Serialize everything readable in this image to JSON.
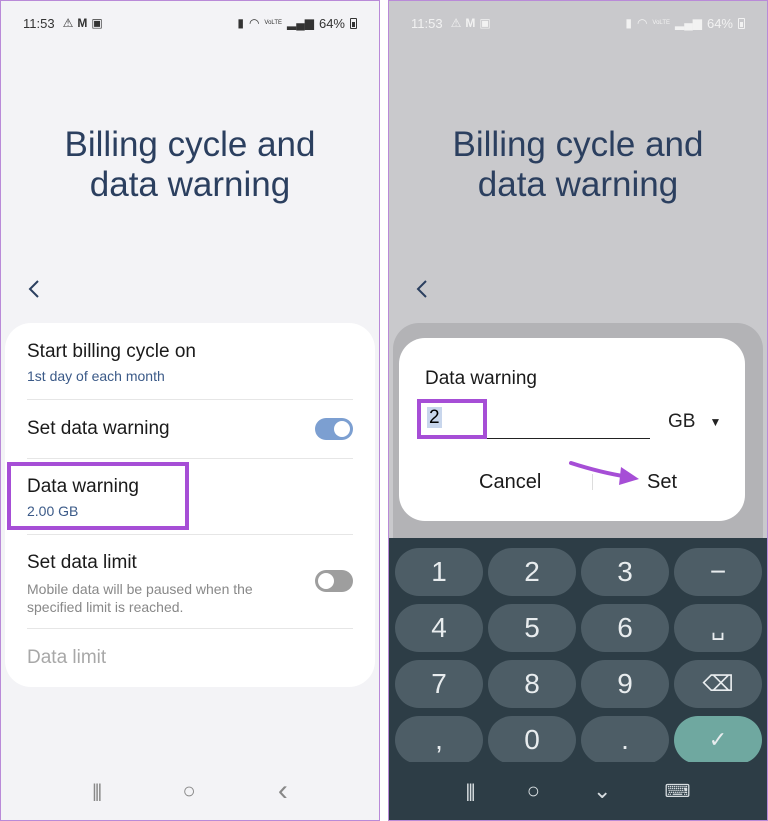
{
  "status": {
    "time": "11:53",
    "battery": "64%",
    "network_label": "VoLTE",
    "icons_left": [
      "warning-icon",
      "gmail-icon",
      "gallery-icon"
    ],
    "icons_right": [
      "sim-icon",
      "wifi-icon",
      "volte-icon",
      "signal-icon",
      "battery-icon"
    ]
  },
  "page_title_line1": "Billing cycle and",
  "page_title_line2": "data warning",
  "settings": {
    "billing_cycle": {
      "title": "Start billing cycle on",
      "value": "1st day of each month"
    },
    "set_data_warning": {
      "title": "Set data warning",
      "toggle": "on"
    },
    "data_warning": {
      "title": "Data warning",
      "value": "2.00 GB"
    },
    "set_data_limit": {
      "title": "Set data limit",
      "description": "Mobile data will be paused when the specified limit is reached.",
      "toggle": "off"
    },
    "data_limit": {
      "title": "Data limit"
    }
  },
  "dialog": {
    "title": "Data warning",
    "input_value": "2",
    "unit": "GB",
    "cancel_label": "Cancel",
    "set_label": "Set"
  },
  "keyboard": {
    "keys": [
      "1",
      "2",
      "3",
      "−",
      "4",
      "5",
      "6",
      "␣",
      "7",
      "8",
      "9",
      "⌫",
      ",",
      "0",
      ".",
      "✓"
    ]
  },
  "nav": {
    "recents": "|||",
    "home": "○",
    "back": "‹",
    "hide_keyboard": "⌄",
    "keyboard_switch": "⌨"
  },
  "colors": {
    "accent_highlight": "#a64ed6",
    "title_blue": "#2b3f5f",
    "subtext_blue": "#3b5a88",
    "toggle_on": "#7c9fd1",
    "keyboard_bg": "#2d3d46",
    "key_bg": "#4d5d66",
    "confirm_key": "#6fa8a0"
  }
}
